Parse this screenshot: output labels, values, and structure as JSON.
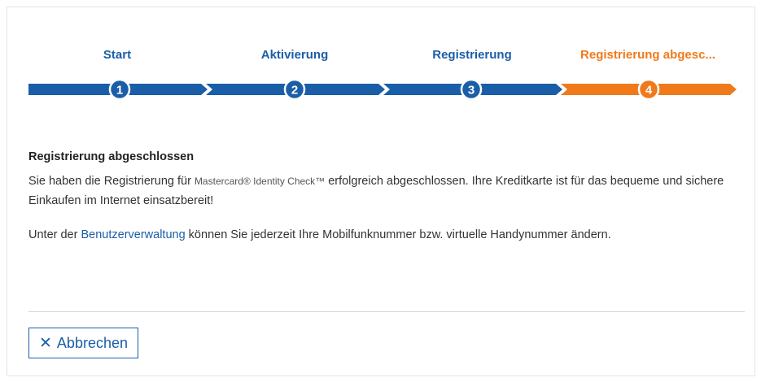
{
  "steps": [
    {
      "label": "Start",
      "number": "1",
      "state": "done"
    },
    {
      "label": "Aktivierung",
      "number": "2",
      "state": "done"
    },
    {
      "label": "Registrierung",
      "number": "3",
      "state": "done"
    },
    {
      "label": "Registrierung abgesc...",
      "number": "4",
      "state": "active"
    }
  ],
  "colors": {
    "step_done": "#1a5ea8",
    "step_active": "#f07a1b",
    "link": "#1a5ea8"
  },
  "main": {
    "heading": "Registrierung abgeschlossen",
    "p1_before": "Sie haben die Registrierung für ",
    "p1_brand": "Mastercard® Identity Check™",
    "p1_after": " erfolgreich abgeschlossen. Ihre Kreditkarte ist für das bequeme und sichere Einkaufen im Internet einsatzbereit!",
    "p2_before": "Unter der ",
    "p2_link": "Benutzerverwaltung",
    "p2_after": " können Sie jederzeit Ihre Mobilfunknummer bzw. virtuelle Handynummer ändern."
  },
  "footer": {
    "cancel_icon": "close-icon",
    "cancel_glyph": "✕",
    "cancel_label": "Abbrechen"
  }
}
